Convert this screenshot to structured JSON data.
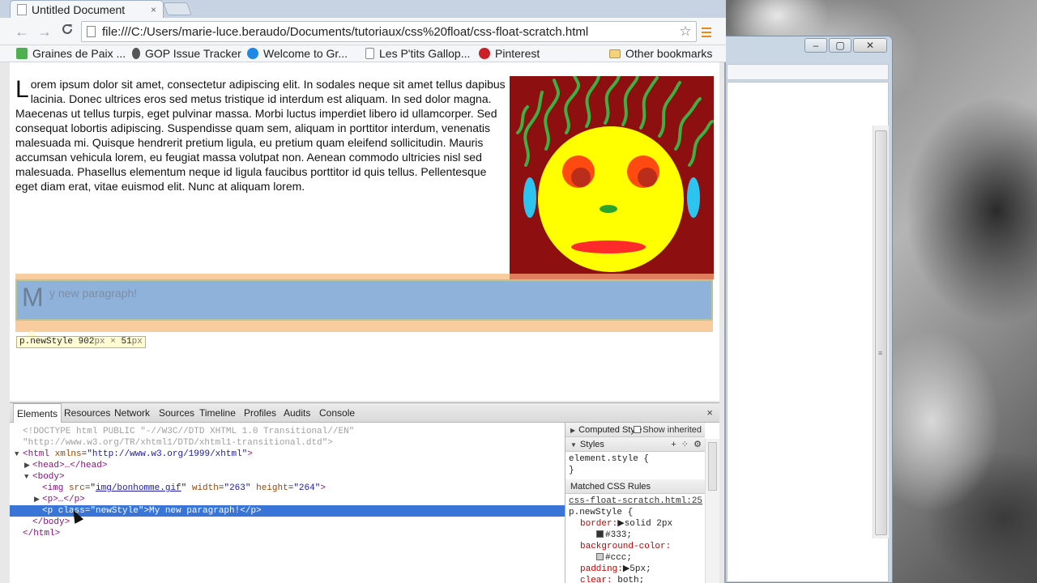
{
  "browser": {
    "tab_title": "Untitled Document",
    "tab_close": "×",
    "url": "file:///C:/Users/marie-luce.beraudo/Documents/tutoriaux/css%20float/css-float-scratch.html",
    "back": "←",
    "forward": "→",
    "reload": "C",
    "star": "☆"
  },
  "bookmarks": {
    "items": [
      {
        "label": "Graines de Paix ...",
        "icon_color": "#4caf50"
      },
      {
        "label": "GOP Issue Tracker",
        "icon_color": "#555555"
      },
      {
        "label": "Welcome to Gr...",
        "icon_color": "#1e88e5"
      },
      {
        "label": "Les P'tits Gallop...",
        "icon_color": "#ffffff"
      },
      {
        "label": "Pinterest",
        "icon_color": "#cb2027"
      }
    ],
    "other": "Other bookmarks"
  },
  "page": {
    "lorem_cap": "L",
    "lorem_rest": "orem ipsum dolor sit amet, consectetur adipiscing elit. In sodales neque sit amet tellus dapibus lacinia. Donec ultrices eros sed metus tristique id interdum est aliquam. In sed dolor magna. Maecenas ut tellus turpis, eget pulvinar massa. Morbi luctus imperdiet libero id ullamcorper. Sed consequat lobortis adipiscing. Suspendisse quam sem, aliquam in porttitor interdum, venenatis malesuada mi. Quisque hendrerit pretium ligula, eu pretium quam eleifend sollicitudin. Mauris accumsan vehicula lorem, eu feugiat massa volutpat non. Aenean commodo ultricies nisl sed malesuada. Phasellus elementum neque id ligula faucibus porttitor id quis tellus. Pellentesque eget diam erat, vitae euismod elit. Nunc at aliquam lorem.",
    "new_p_cap": "M",
    "new_p_rest": "y new paragraph!",
    "tooltip_selector": "p.newStyle",
    "tooltip_w": "902",
    "tooltip_h": "51",
    "tooltip_unit": "px",
    "tooltip_times": "×"
  },
  "devtools": {
    "tabs": [
      "Elements",
      "Resources",
      "Network",
      "Sources",
      "Timeline",
      "Profiles",
      "Audits",
      "Console"
    ],
    "close": "×",
    "dom": {
      "doctype1": "<!DOCTYPE html PUBLIC \"-//W3C//DTD XHTML 1.0 Transitional//EN\"",
      "doctype2": "\"http://www.w3.org/TR/xhtml1/DTD/xhtml1-transitional.dtd\">",
      "html_open_tag": "<html",
      "html_attr": "xmlns",
      "html_val": "\"http://www.w3.org/1999/xhtml\"",
      "head": "<head>…</head>",
      "body_open": "<body>",
      "img_tag": "<img",
      "img_src_attr": "src",
      "img_src_val": "img/bonhomme.gif",
      "img_w_attr": "width",
      "img_w_val": "\"263\"",
      "img_h_attr": "height",
      "img_h_val": "\"264\"",
      "p_collapsed": "<p>…</p>",
      "sel_p": "<p class=\"newStyle\">My new paragraph!</p>",
      "body_close": "</body>",
      "html_close": "</html>"
    },
    "side": {
      "computed": "Computed Style",
      "show_inherited": "Show inherited",
      "styles": "Styles",
      "element_style": "element.style {",
      "close_brace": "}",
      "matched": "Matched CSS Rules",
      "source": "css-float-scratch.html:25",
      "selector": "p.newStyle {",
      "border_prop": "border:",
      "border_val": "solid 2px",
      "border_color": "#333;",
      "bg_prop": "background-color:",
      "bg_color": "#ccc;",
      "padding_prop": "padding:",
      "padding_val": "5px;",
      "clear_prop": "clear:",
      "clear_val": "both;"
    }
  },
  "colors": {
    "accent_menu": "#e58a14",
    "selection": "#3875d7",
    "swatch_333": "#333333",
    "swatch_ccc": "#cccccc",
    "face_bg": "#8e0f0f",
    "face": "#ffff00",
    "hair": "#3cb043"
  }
}
